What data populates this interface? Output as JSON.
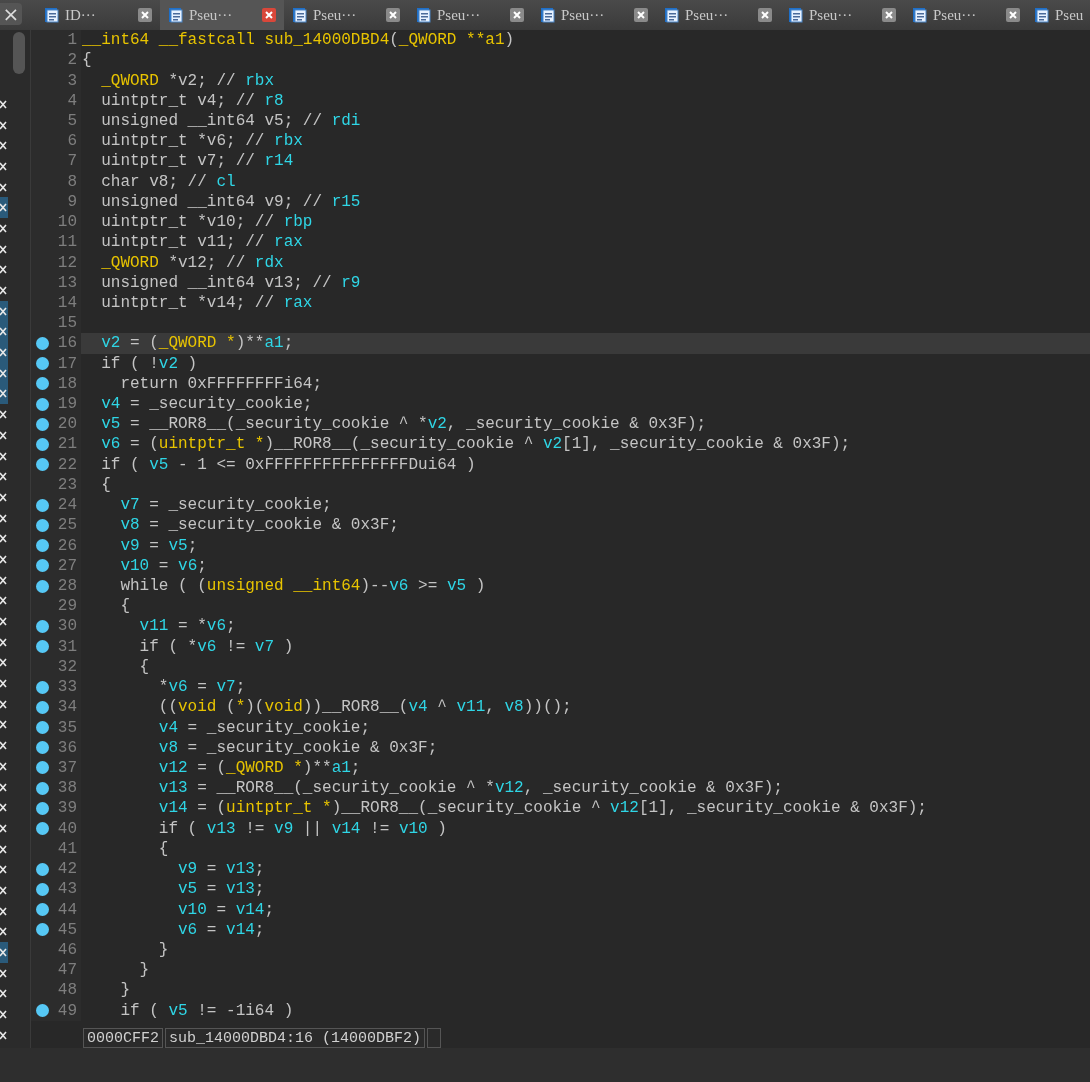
{
  "panel_close": "×",
  "tabs": [
    {
      "label": "ID···",
      "selected": false,
      "closable": true
    },
    {
      "label": "Pseu···",
      "selected": true,
      "closable": true
    },
    {
      "label": "Pseu···",
      "selected": false,
      "closable": true
    },
    {
      "label": "Pseu···",
      "selected": false,
      "closable": true
    },
    {
      "label": "Pseu···",
      "selected": false,
      "closable": true
    },
    {
      "label": "Pseu···",
      "selected": false,
      "closable": true
    },
    {
      "label": "Pseu···",
      "selected": false,
      "closable": true
    },
    {
      "label": "Pseu···",
      "selected": false,
      "closable": true
    },
    {
      "label": "Pseu",
      "selected": false,
      "closable": false
    }
  ],
  "function_list": [
    {
      "selected": false
    },
    {
      "selected": false
    },
    {
      "selected": false
    },
    {
      "selected": false
    },
    {
      "selected": false
    },
    {
      "selected": true
    },
    {
      "selected": false
    },
    {
      "selected": false
    },
    {
      "selected": false
    },
    {
      "selected": false
    },
    {
      "selected": true
    },
    {
      "selected": true
    },
    {
      "selected": true
    },
    {
      "selected": true
    },
    {
      "selected": true
    },
    {
      "selected": false
    },
    {
      "selected": false
    },
    {
      "selected": false
    },
    {
      "selected": false
    },
    {
      "selected": false
    },
    {
      "selected": false
    },
    {
      "selected": false
    },
    {
      "selected": false
    },
    {
      "selected": false
    },
    {
      "selected": false
    },
    {
      "selected": false
    },
    {
      "selected": false
    },
    {
      "selected": false
    },
    {
      "selected": false
    },
    {
      "selected": false
    },
    {
      "selected": false
    },
    {
      "selected": false
    },
    {
      "selected": false
    },
    {
      "selected": false
    },
    {
      "selected": false
    },
    {
      "selected": false
    },
    {
      "selected": false
    },
    {
      "selected": false
    },
    {
      "selected": false
    },
    {
      "selected": false
    },
    {
      "selected": false
    },
    {
      "selected": true
    },
    {
      "selected": false
    },
    {
      "selected": false
    },
    {
      "selected": false
    },
    {
      "selected": false
    }
  ],
  "lines": [
    {
      "number": "1",
      "marked": false,
      "current": false,
      "tokens": [
        {
          "kind": "type",
          "text": "__int64 __fastcall sub_14000DBD4"
        },
        {
          "kind": "plain",
          "text": "("
        },
        {
          "kind": "type",
          "text": "_QWORD **a1"
        },
        {
          "kind": "plain",
          "text": ")"
        }
      ]
    },
    {
      "number": "2",
      "marked": false,
      "current": false,
      "tokens": [
        {
          "kind": "plain",
          "text": "{"
        }
      ]
    },
    {
      "number": "3",
      "marked": false,
      "current": false,
      "tokens": [
        {
          "kind": "type",
          "text": "  _QWORD"
        },
        {
          "kind": "plain",
          "text": " *v2; // "
        },
        {
          "kind": "var",
          "text": "rbx"
        }
      ]
    },
    {
      "number": "4",
      "marked": false,
      "current": false,
      "tokens": [
        {
          "kind": "plain",
          "text": "  uintptr_t v4; // "
        },
        {
          "kind": "var",
          "text": "r8"
        }
      ]
    },
    {
      "number": "5",
      "marked": false,
      "current": false,
      "tokens": [
        {
          "kind": "plain",
          "text": "  unsigned __int64 v5; // "
        },
        {
          "kind": "var",
          "text": "rdi"
        }
      ]
    },
    {
      "number": "6",
      "marked": false,
      "current": false,
      "tokens": [
        {
          "kind": "plain",
          "text": "  uintptr_t *v6; // "
        },
        {
          "kind": "var",
          "text": "rbx"
        }
      ]
    },
    {
      "number": "7",
      "marked": false,
      "current": false,
      "tokens": [
        {
          "kind": "plain",
          "text": "  uintptr_t v7; // "
        },
        {
          "kind": "var",
          "text": "r14"
        }
      ]
    },
    {
      "number": "8",
      "marked": false,
      "current": false,
      "tokens": [
        {
          "kind": "plain",
          "text": "  char v8; // "
        },
        {
          "kind": "var",
          "text": "cl"
        }
      ]
    },
    {
      "number": "9",
      "marked": false,
      "current": false,
      "tokens": [
        {
          "kind": "plain",
          "text": "  unsigned __int64 v9; // "
        },
        {
          "kind": "var",
          "text": "r15"
        }
      ]
    },
    {
      "number": "10",
      "marked": false,
      "current": false,
      "tokens": [
        {
          "kind": "plain",
          "text": "  uintptr_t *v10; // "
        },
        {
          "kind": "var",
          "text": "rbp"
        }
      ]
    },
    {
      "number": "11",
      "marked": false,
      "current": false,
      "tokens": [
        {
          "kind": "plain",
          "text": "  uintptr_t v11; // "
        },
        {
          "kind": "var",
          "text": "rax"
        }
      ]
    },
    {
      "number": "12",
      "marked": false,
      "current": false,
      "tokens": [
        {
          "kind": "type",
          "text": "  _QWORD"
        },
        {
          "kind": "plain",
          "text": " *v12; // "
        },
        {
          "kind": "var",
          "text": "rdx"
        }
      ]
    },
    {
      "number": "13",
      "marked": false,
      "current": false,
      "tokens": [
        {
          "kind": "plain",
          "text": "  unsigned __int64 v13; // "
        },
        {
          "kind": "var",
          "text": "r9"
        }
      ]
    },
    {
      "number": "14",
      "marked": false,
      "current": false,
      "tokens": [
        {
          "kind": "plain",
          "text": "  uintptr_t *v14; // "
        },
        {
          "kind": "var",
          "text": "rax"
        }
      ]
    },
    {
      "number": "15",
      "marked": false,
      "current": false
    },
    {
      "number": "16",
      "marked": true,
      "current": true,
      "tokens": [
        {
          "kind": "var",
          "text": "  v2"
        },
        {
          "kind": "plain",
          "text": " = ("
        },
        {
          "kind": "type",
          "text": "_QWORD *"
        },
        {
          "kind": "plain",
          "text": ")**"
        },
        {
          "kind": "var",
          "text": "a1"
        },
        {
          "kind": "plain",
          "text": ";"
        }
      ]
    },
    {
      "number": "17",
      "marked": true,
      "current": false,
      "tokens": [
        {
          "kind": "plain",
          "text": "  if ( !"
        },
        {
          "kind": "var",
          "text": "v2"
        },
        {
          "kind": "plain",
          "text": " )"
        }
      ]
    },
    {
      "number": "18",
      "marked": true,
      "current": false,
      "tokens": [
        {
          "kind": "plain",
          "text": "    return 0xFFFFFFFFi64;"
        }
      ]
    },
    {
      "number": "19",
      "marked": true,
      "current": false,
      "tokens": [
        {
          "kind": "var",
          "text": "  v4"
        },
        {
          "kind": "plain",
          "text": " = _security_cookie;"
        }
      ]
    },
    {
      "number": "20",
      "marked": true,
      "current": false,
      "tokens": [
        {
          "kind": "var",
          "text": "  v5"
        },
        {
          "kind": "plain",
          "text": " = __ROR8__(_security_cookie ^ *"
        },
        {
          "kind": "var",
          "text": "v2"
        },
        {
          "kind": "plain",
          "text": ", _security_cookie & 0x3F);"
        }
      ]
    },
    {
      "number": "21",
      "marked": true,
      "current": false,
      "tokens": [
        {
          "kind": "var",
          "text": "  v6"
        },
        {
          "kind": "plain",
          "text": " = ("
        },
        {
          "kind": "type",
          "text": "uintptr_t *"
        },
        {
          "kind": "plain",
          "text": ")__ROR8__(_security_cookie ^ "
        },
        {
          "kind": "var",
          "text": "v2"
        },
        {
          "kind": "plain",
          "text": "[1], _security_cookie & 0x3F);"
        }
      ]
    },
    {
      "number": "22",
      "marked": true,
      "current": false,
      "tokens": [
        {
          "kind": "plain",
          "text": "  if ( "
        },
        {
          "kind": "var",
          "text": "v5"
        },
        {
          "kind": "plain",
          "text": " - 1 <= 0xFFFFFFFFFFFFFFFDui64 )"
        }
      ]
    },
    {
      "number": "23",
      "marked": false,
      "current": false,
      "tokens": [
        {
          "kind": "plain",
          "text": "  {"
        }
      ]
    },
    {
      "number": "24",
      "marked": true,
      "current": false,
      "tokens": [
        {
          "kind": "var",
          "text": "    v7"
        },
        {
          "kind": "plain",
          "text": " = _security_cookie;"
        }
      ]
    },
    {
      "number": "25",
      "marked": true,
      "current": false,
      "tokens": [
        {
          "kind": "var",
          "text": "    v8"
        },
        {
          "kind": "plain",
          "text": " = _security_cookie & 0x3F;"
        }
      ]
    },
    {
      "number": "26",
      "marked": true,
      "current": false,
      "tokens": [
        {
          "kind": "var",
          "text": "    v9"
        },
        {
          "kind": "plain",
          "text": " = "
        },
        {
          "kind": "var",
          "text": "v5"
        },
        {
          "kind": "plain",
          "text": ";"
        }
      ]
    },
    {
      "number": "27",
      "marked": true,
      "current": false,
      "tokens": [
        {
          "kind": "var",
          "text": "    v10"
        },
        {
          "kind": "plain",
          "text": " = "
        },
        {
          "kind": "var",
          "text": "v6"
        },
        {
          "kind": "plain",
          "text": ";"
        }
      ]
    },
    {
      "number": "28",
      "marked": true,
      "current": false,
      "tokens": [
        {
          "kind": "plain",
          "text": "    while ( ("
        },
        {
          "kind": "type",
          "text": "unsigned __int64"
        },
        {
          "kind": "plain",
          "text": ")--"
        },
        {
          "kind": "var",
          "text": "v6"
        },
        {
          "kind": "plain",
          "text": " >= "
        },
        {
          "kind": "var",
          "text": "v5"
        },
        {
          "kind": "plain",
          "text": " )"
        }
      ]
    },
    {
      "number": "29",
      "marked": false,
      "current": false,
      "tokens": [
        {
          "kind": "plain",
          "text": "    {"
        }
      ]
    },
    {
      "number": "30",
      "marked": true,
      "current": false,
      "tokens": [
        {
          "kind": "var",
          "text": "      v11"
        },
        {
          "kind": "plain",
          "text": " = *"
        },
        {
          "kind": "var",
          "text": "v6"
        },
        {
          "kind": "plain",
          "text": ";"
        }
      ]
    },
    {
      "number": "31",
      "marked": true,
      "current": false,
      "tokens": [
        {
          "kind": "plain",
          "text": "      if ( *"
        },
        {
          "kind": "var",
          "text": "v6"
        },
        {
          "kind": "plain",
          "text": " != "
        },
        {
          "kind": "var",
          "text": "v7"
        },
        {
          "kind": "plain",
          "text": " )"
        }
      ]
    },
    {
      "number": "32",
      "marked": false,
      "current": false,
      "tokens": [
        {
          "kind": "plain",
          "text": "      {"
        }
      ]
    },
    {
      "number": "33",
      "marked": true,
      "current": false,
      "tokens": [
        {
          "kind": "plain",
          "text": "        *"
        },
        {
          "kind": "var",
          "text": "v6"
        },
        {
          "kind": "plain",
          "text": " = "
        },
        {
          "kind": "var",
          "text": "v7"
        },
        {
          "kind": "plain",
          "text": ";"
        }
      ]
    },
    {
      "number": "34",
      "marked": true,
      "current": false,
      "tokens": [
        {
          "kind": "plain",
          "text": "        (("
        },
        {
          "kind": "type",
          "text": "void"
        },
        {
          "kind": "plain",
          "text": " ("
        },
        {
          "kind": "type",
          "text": "*"
        },
        {
          "kind": "plain",
          "text": ")("
        },
        {
          "kind": "type",
          "text": "void"
        },
        {
          "kind": "plain",
          "text": "))__ROR8__("
        },
        {
          "kind": "var",
          "text": "v4"
        },
        {
          "kind": "plain",
          "text": " ^ "
        },
        {
          "kind": "var",
          "text": "v11"
        },
        {
          "kind": "plain",
          "text": ", "
        },
        {
          "kind": "var",
          "text": "v8"
        },
        {
          "kind": "plain",
          "text": "))();"
        }
      ]
    },
    {
      "number": "35",
      "marked": true,
      "current": false,
      "tokens": [
        {
          "kind": "var",
          "text": "        v4"
        },
        {
          "kind": "plain",
          "text": " = _security_cookie;"
        }
      ]
    },
    {
      "number": "36",
      "marked": true,
      "current": false,
      "tokens": [
        {
          "kind": "var",
          "text": "        v8"
        },
        {
          "kind": "plain",
          "text": " = _security_cookie & 0x3F;"
        }
      ]
    },
    {
      "number": "37",
      "marked": true,
      "current": false,
      "tokens": [
        {
          "kind": "var",
          "text": "        v12"
        },
        {
          "kind": "plain",
          "text": " = ("
        },
        {
          "kind": "type",
          "text": "_QWORD *"
        },
        {
          "kind": "plain",
          "text": ")**"
        },
        {
          "kind": "var",
          "text": "a1"
        },
        {
          "kind": "plain",
          "text": ";"
        }
      ]
    },
    {
      "number": "38",
      "marked": true,
      "current": false,
      "tokens": [
        {
          "kind": "var",
          "text": "        v13"
        },
        {
          "kind": "plain",
          "text": " = __ROR8__(_security_cookie ^ *"
        },
        {
          "kind": "var",
          "text": "v12"
        },
        {
          "kind": "plain",
          "text": ", _security_cookie & 0x3F);"
        }
      ]
    },
    {
      "number": "39",
      "marked": true,
      "current": false,
      "tokens": [
        {
          "kind": "var",
          "text": "        v14"
        },
        {
          "kind": "plain",
          "text": " = ("
        },
        {
          "kind": "type",
          "text": "uintptr_t *"
        },
        {
          "kind": "plain",
          "text": ")__ROR8__(_security_cookie ^ "
        },
        {
          "kind": "var",
          "text": "v12"
        },
        {
          "kind": "plain",
          "text": "[1], _security_cookie & 0x3F);"
        }
      ]
    },
    {
      "number": "40",
      "marked": true,
      "current": false,
      "tokens": [
        {
          "kind": "plain",
          "text": "        if ( "
        },
        {
          "kind": "var",
          "text": "v13"
        },
        {
          "kind": "plain",
          "text": " != "
        },
        {
          "kind": "var",
          "text": "v9"
        },
        {
          "kind": "plain",
          "text": " || "
        },
        {
          "kind": "var",
          "text": "v14"
        },
        {
          "kind": "plain",
          "text": " != "
        },
        {
          "kind": "var",
          "text": "v10"
        },
        {
          "kind": "plain",
          "text": " )"
        }
      ]
    },
    {
      "number": "41",
      "marked": false,
      "current": false,
      "tokens": [
        {
          "kind": "plain",
          "text": "        {"
        }
      ]
    },
    {
      "number": "42",
      "marked": true,
      "current": false,
      "tokens": [
        {
          "kind": "var",
          "text": "          v9"
        },
        {
          "kind": "plain",
          "text": " = "
        },
        {
          "kind": "var",
          "text": "v13"
        },
        {
          "kind": "plain",
          "text": ";"
        }
      ]
    },
    {
      "number": "43",
      "marked": true,
      "current": false,
      "tokens": [
        {
          "kind": "var",
          "text": "          v5"
        },
        {
          "kind": "plain",
          "text": " = "
        },
        {
          "kind": "var",
          "text": "v13"
        },
        {
          "kind": "plain",
          "text": ";"
        }
      ]
    },
    {
      "number": "44",
      "marked": true,
      "current": false,
      "tokens": [
        {
          "kind": "var",
          "text": "          v10"
        },
        {
          "kind": "plain",
          "text": " = "
        },
        {
          "kind": "var",
          "text": "v14"
        },
        {
          "kind": "plain",
          "text": ";"
        }
      ]
    },
    {
      "number": "45",
      "marked": true,
      "current": false,
      "tokens": [
        {
          "kind": "var",
          "text": "          v6"
        },
        {
          "kind": "plain",
          "text": " = "
        },
        {
          "kind": "var",
          "text": "v14"
        },
        {
          "kind": "plain",
          "text": ";"
        }
      ]
    },
    {
      "number": "46",
      "marked": false,
      "current": false,
      "tokens": [
        {
          "kind": "plain",
          "text": "        }"
        }
      ]
    },
    {
      "number": "47",
      "marked": false,
      "current": false,
      "tokens": [
        {
          "kind": "plain",
          "text": "      }"
        }
      ]
    },
    {
      "number": "48",
      "marked": false,
      "current": false,
      "tokens": [
        {
          "kind": "plain",
          "text": "    }"
        }
      ]
    },
    {
      "number": "49",
      "marked": true,
      "current": false,
      "tokens": [
        {
          "kind": "plain",
          "text": "    if ( "
        },
        {
          "kind": "var",
          "text": "v5"
        },
        {
          "kind": "plain",
          "text": " != -1i64 )"
        }
      ]
    }
  ],
  "status_bar": {
    "address": "0000CFF2",
    "location": "sub_14000DBD4:16 (14000DBF2)"
  }
}
